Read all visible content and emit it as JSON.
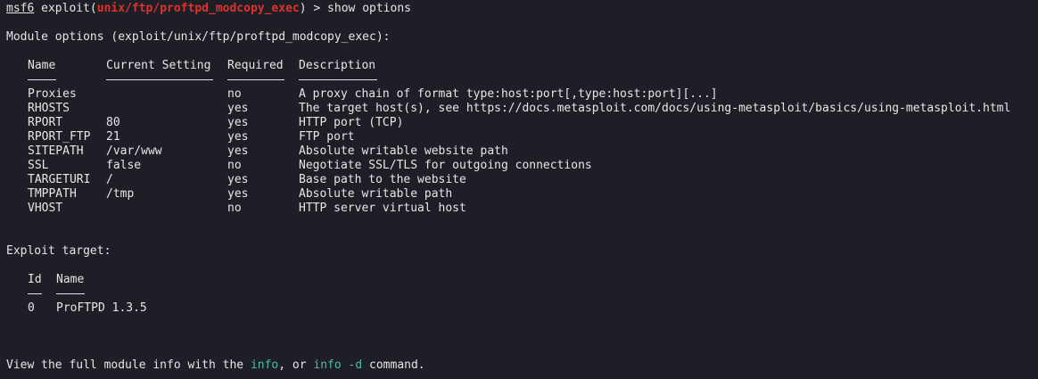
{
  "prompt": {
    "name": "msf6",
    "exploit_word": "exploit(",
    "module": "unix/ftp/proftpd_modcopy_exec",
    "suffix": ") > show options"
  },
  "module_options": {
    "heading": "Module options (exploit/unix/ftp/proftpd_modcopy_exec):",
    "headers": [
      "Name",
      "Current Setting",
      "Required",
      "Description"
    ],
    "rows": [
      {
        "name": "Proxies",
        "setting": "",
        "required": "no",
        "description": "A proxy chain of format type:host:port[,type:host:port][...]"
      },
      {
        "name": "RHOSTS",
        "setting": "",
        "required": "yes",
        "description": "The target host(s), see https://docs.metasploit.com/docs/using-metasploit/basics/using-metasploit.html"
      },
      {
        "name": "RPORT",
        "setting": "80",
        "required": "yes",
        "description": "HTTP port (TCP)"
      },
      {
        "name": "RPORT_FTP",
        "setting": "21",
        "required": "yes",
        "description": "FTP port"
      },
      {
        "name": "SITEPATH",
        "setting": "/var/www",
        "required": "yes",
        "description": "Absolute writable website path"
      },
      {
        "name": "SSL",
        "setting": "false",
        "required": "no",
        "description": "Negotiate SSL/TLS for outgoing connections"
      },
      {
        "name": "TARGETURI",
        "setting": "/",
        "required": "yes",
        "description": "Base path to the website"
      },
      {
        "name": "TMPPATH",
        "setting": "/tmp",
        "required": "yes",
        "description": "Absolute writable path"
      },
      {
        "name": "VHOST",
        "setting": "",
        "required": "no",
        "description": "HTTP server virtual host"
      }
    ]
  },
  "exploit_target": {
    "heading": "Exploit target:",
    "headers": [
      "Id",
      "Name"
    ],
    "rows": [
      {
        "id": "0",
        "name": "ProFTPD 1.3.5"
      }
    ]
  },
  "footer": {
    "prefix": "View the full module info with the ",
    "cmd1": "info",
    "middle": ", or ",
    "cmd2": "info -d",
    "suffix": " command."
  },
  "colors": {
    "background": "#1e1f26",
    "text": "#e6e6e6",
    "module_highlight": "#e0312f",
    "command_highlight": "#4fb8a8"
  }
}
